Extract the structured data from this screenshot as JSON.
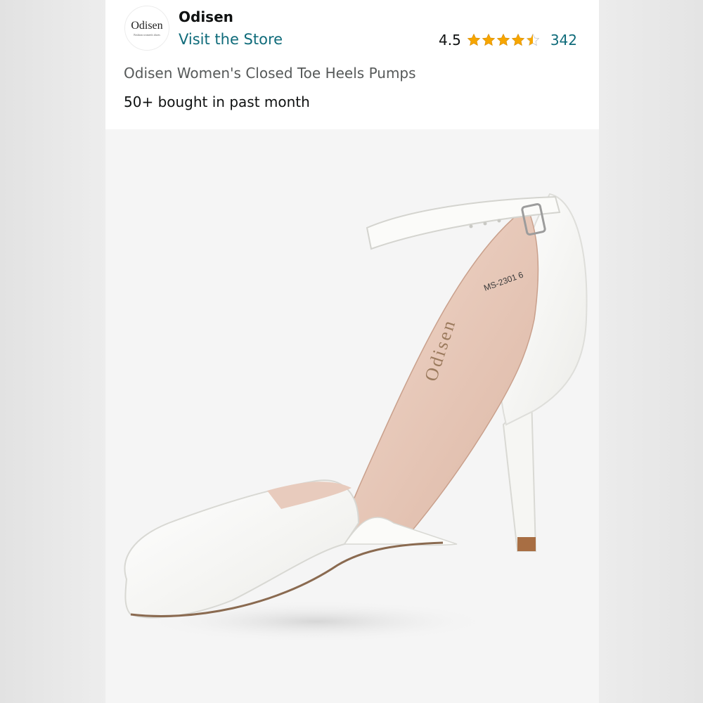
{
  "seller": {
    "brand_name": "Odisen",
    "store_link_label": "Visit the Store",
    "logo_text": "Odisen",
    "logo_tagline": "Fashion women's shoes"
  },
  "rating": {
    "value": "4.5",
    "stars_filled": 4.5,
    "stars_total": 5,
    "star_color": "#f7a600",
    "review_count": "342"
  },
  "product": {
    "title": "Odisen Women's Closed Toe Heels Pumps",
    "bought_text": "50+ bought in past month",
    "insole_brand": "Odisen",
    "insole_model": "MS-2301 6"
  },
  "colors": {
    "link": "#0f6b7a",
    "text": "#0f1111",
    "muted_text": "#565959",
    "shoe_white": "#fbfbf9",
    "lining": "#e7c6b6"
  }
}
